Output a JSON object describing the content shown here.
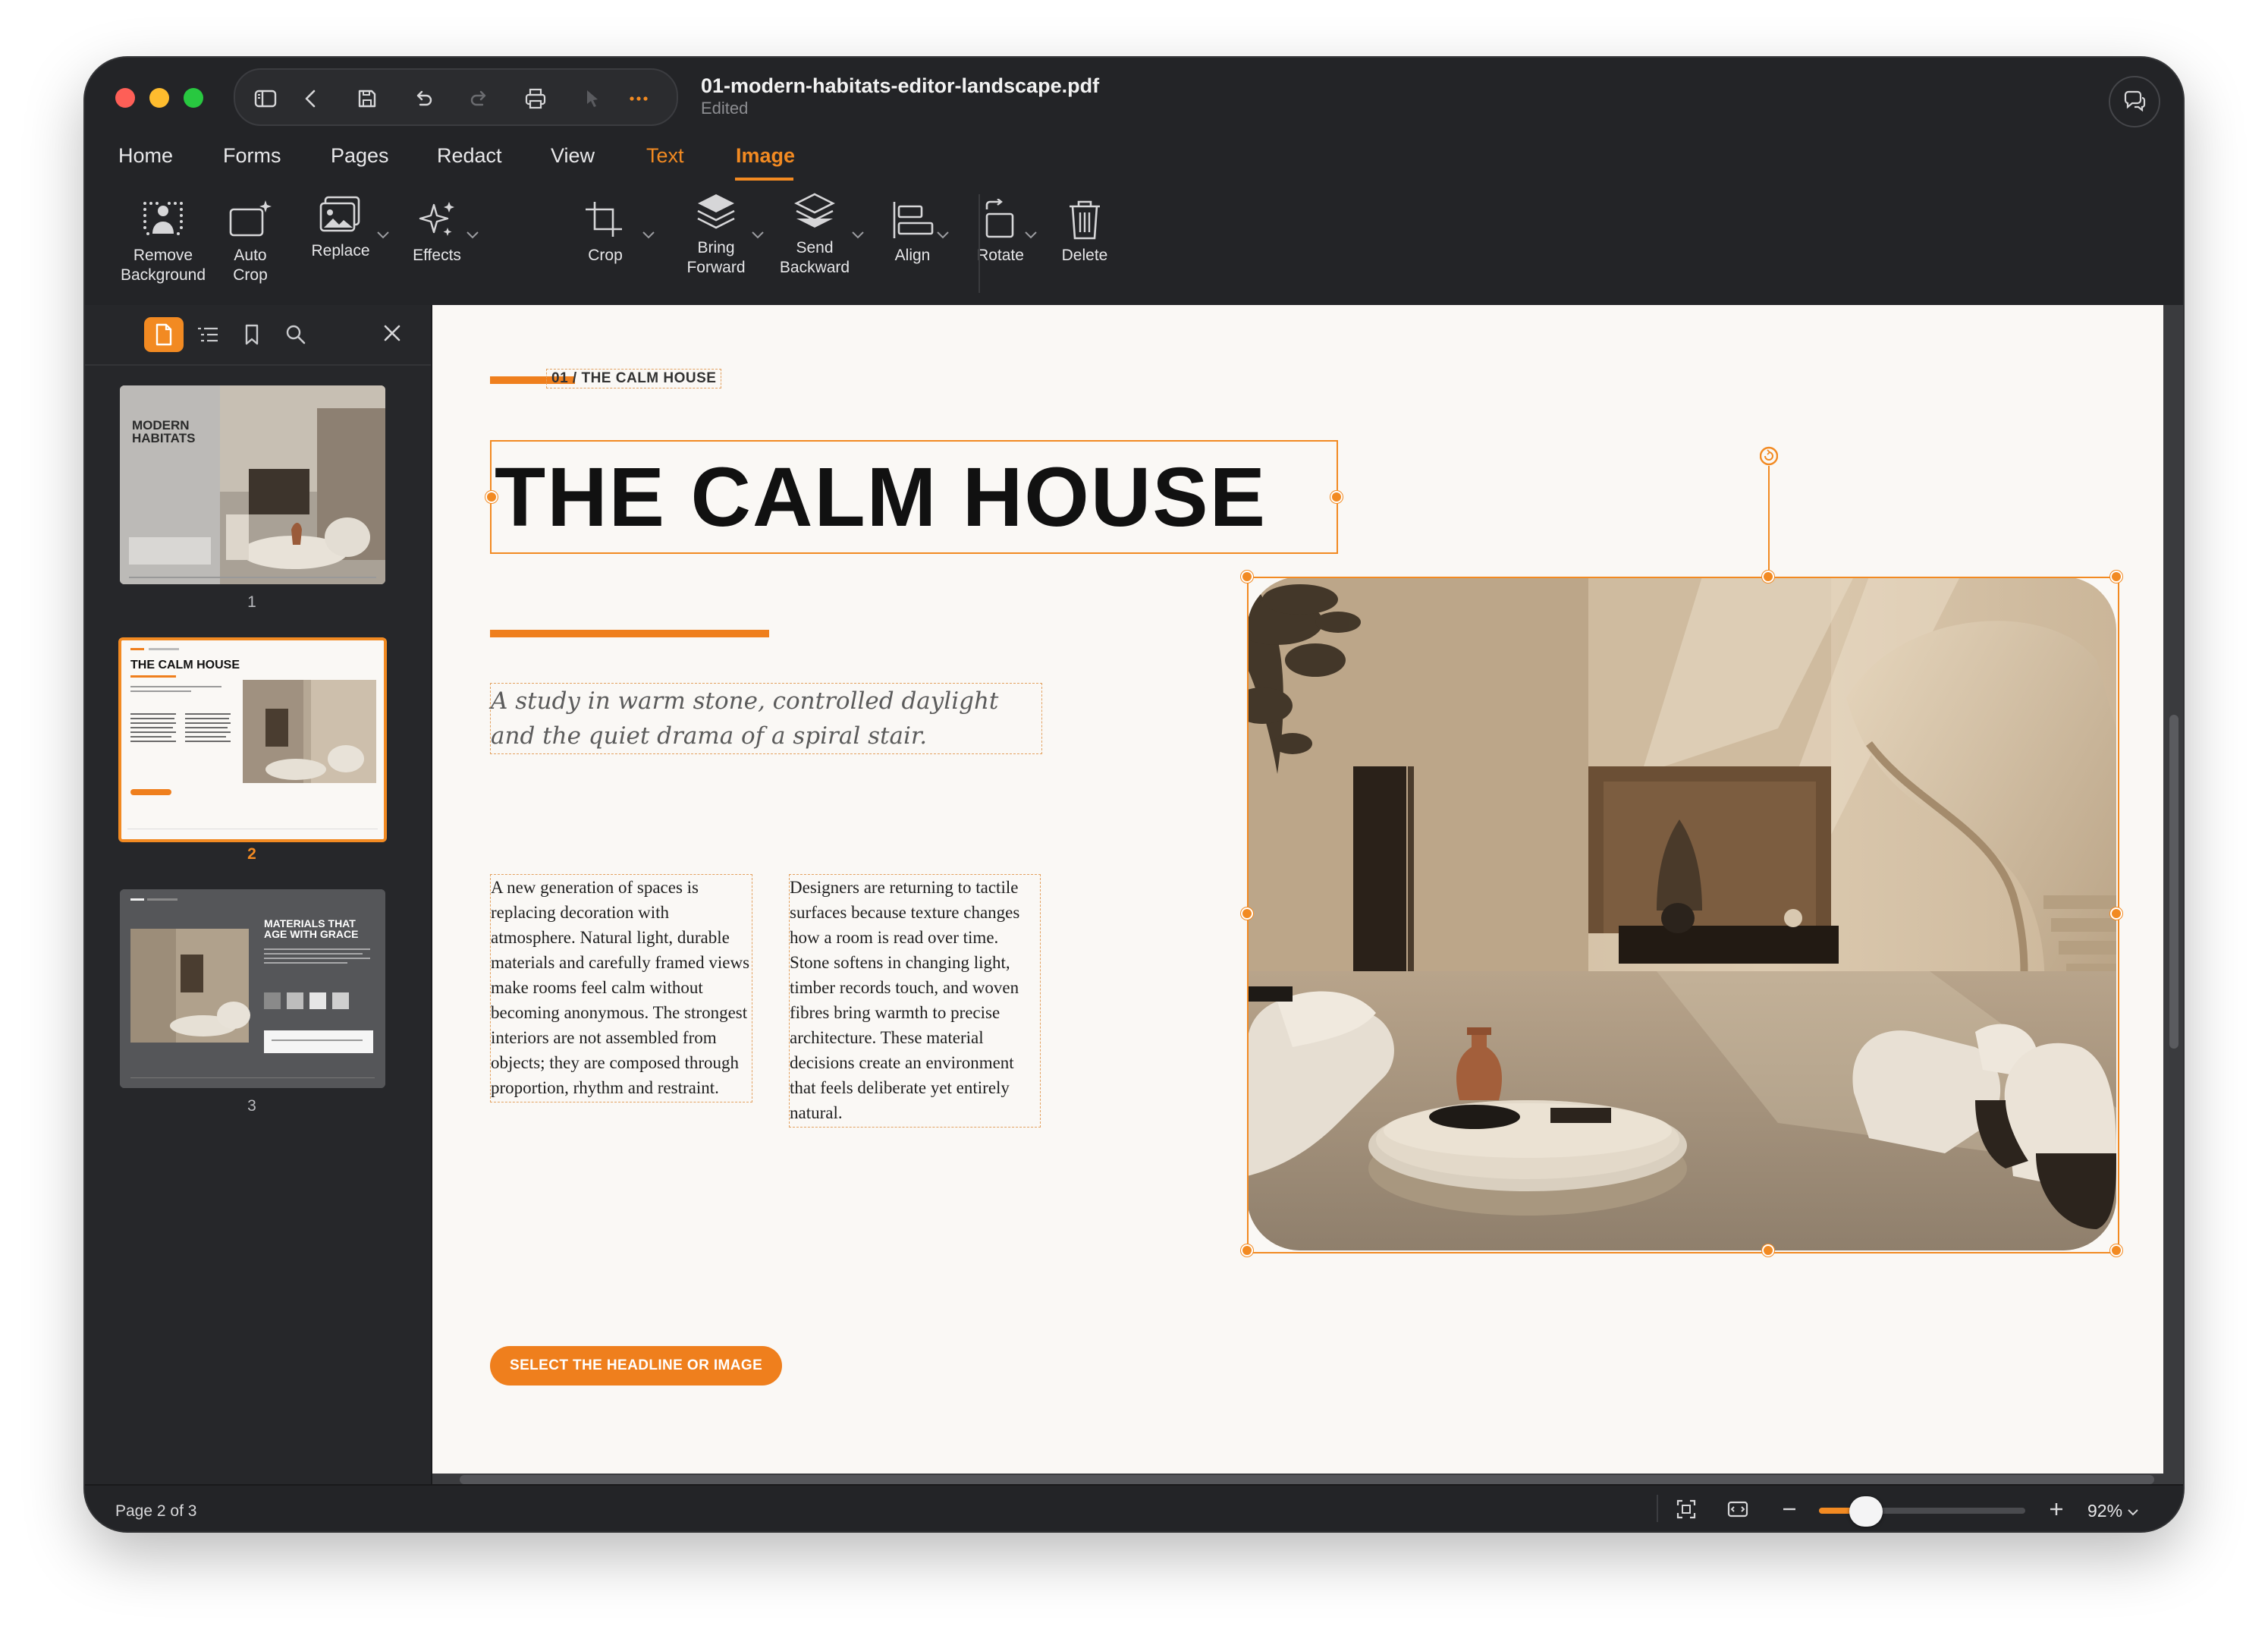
{
  "window": {
    "filename": "01-modern-habitats-editor-landscape.pdf",
    "status": "Edited"
  },
  "menu": {
    "items": [
      {
        "label": "Home"
      },
      {
        "label": "Forms"
      },
      {
        "label": "Pages"
      },
      {
        "label": "Redact"
      },
      {
        "label": "View"
      },
      {
        "label": "Text"
      },
      {
        "label": "Image"
      }
    ],
    "active": "Image"
  },
  "toolbar": {
    "tools": [
      {
        "label": "Remove\nBackground",
        "icon": "remove-background-icon"
      },
      {
        "label": "Auto\nCrop",
        "icon": "auto-crop-icon"
      },
      {
        "label": "Replace",
        "icon": "replace-image-icon"
      },
      {
        "label": "Effects",
        "icon": "sparkle-icon"
      },
      {
        "label": "Crop",
        "icon": "crop-icon"
      },
      {
        "label": "Bring\nForward",
        "icon": "bring-forward-icon"
      },
      {
        "label": "Send\nBackward",
        "icon": "send-backward-icon"
      },
      {
        "label": "Align",
        "icon": "align-left-icon"
      },
      {
        "label": "Rotate",
        "icon": "rotate-icon"
      },
      {
        "label": "Delete",
        "icon": "trash-icon"
      }
    ]
  },
  "sidebar": {
    "thumbnails": [
      {
        "page": "1",
        "title": "MODERN\nHABITATS"
      },
      {
        "page": "2",
        "title": "THE CALM HOUSE"
      },
      {
        "page": "3",
        "title": "MATERIALS THAT\nAGE WITH GRACE"
      }
    ],
    "selected_page": "2"
  },
  "document": {
    "eyebrow": "01 / THE CALM HOUSE",
    "headline": "THE CALM HOUSE",
    "subtitle": "A study in warm stone, controlled daylight and the quiet drama of a spiral stair.",
    "column1": "A new generation of spaces is replacing decoration with atmosphere. Natural light, durable materials and carefully framed views make rooms feel calm without becoming anonymous. The strongest interiors are not assembled from objects; they are composed through proportion, rhythm and restraint.",
    "column2": "Designers are returning to tactile surfaces because texture changes how a room is read over time. Stone softens in changing light, timber records touch, and woven fibres bring warmth to precise architecture. These material decisions create an environment that feels deliberate yet entirely natural.",
    "cta": "SELECT THE HEADLINE OR IMAGE"
  },
  "statusbar": {
    "page_indicator": "Page 2 of 3",
    "zoom": "92%",
    "zoom_level_fraction": 0.24
  },
  "colors": {
    "accent": "#f28a22",
    "window_bg": "#232427",
    "page_bg": "#faf8f5"
  }
}
